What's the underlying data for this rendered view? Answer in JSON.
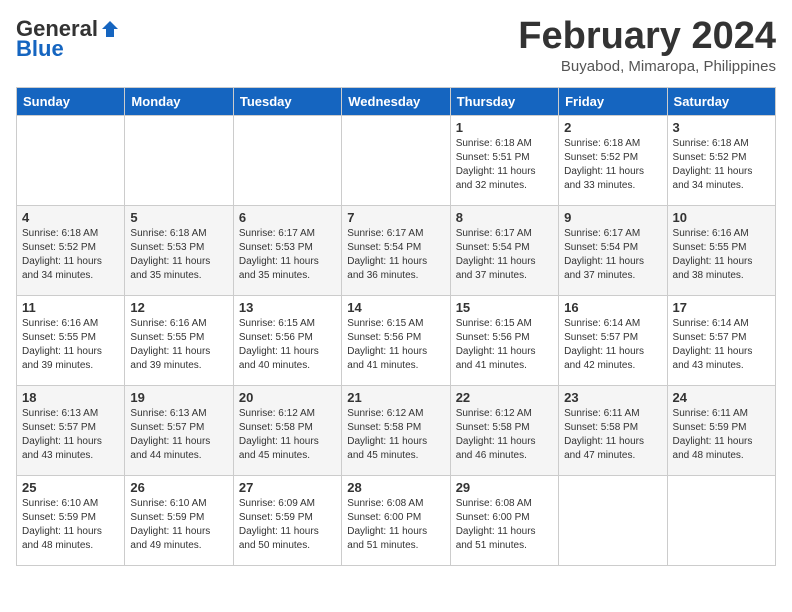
{
  "header": {
    "logo_general": "General",
    "logo_blue": "Blue",
    "month_title": "February 2024",
    "subtitle": "Buyabod, Mimaropa, Philippines"
  },
  "weekdays": [
    "Sunday",
    "Monday",
    "Tuesday",
    "Wednesday",
    "Thursday",
    "Friday",
    "Saturday"
  ],
  "weeks": [
    [
      {
        "day": "",
        "info": ""
      },
      {
        "day": "",
        "info": ""
      },
      {
        "day": "",
        "info": ""
      },
      {
        "day": "",
        "info": ""
      },
      {
        "day": "1",
        "info": "Sunrise: 6:18 AM\nSunset: 5:51 PM\nDaylight: 11 hours\nand 32 minutes."
      },
      {
        "day": "2",
        "info": "Sunrise: 6:18 AM\nSunset: 5:52 PM\nDaylight: 11 hours\nand 33 minutes."
      },
      {
        "day": "3",
        "info": "Sunrise: 6:18 AM\nSunset: 5:52 PM\nDaylight: 11 hours\nand 34 minutes."
      }
    ],
    [
      {
        "day": "4",
        "info": "Sunrise: 6:18 AM\nSunset: 5:52 PM\nDaylight: 11 hours\nand 34 minutes."
      },
      {
        "day": "5",
        "info": "Sunrise: 6:18 AM\nSunset: 5:53 PM\nDaylight: 11 hours\nand 35 minutes."
      },
      {
        "day": "6",
        "info": "Sunrise: 6:17 AM\nSunset: 5:53 PM\nDaylight: 11 hours\nand 35 minutes."
      },
      {
        "day": "7",
        "info": "Sunrise: 6:17 AM\nSunset: 5:54 PM\nDaylight: 11 hours\nand 36 minutes."
      },
      {
        "day": "8",
        "info": "Sunrise: 6:17 AM\nSunset: 5:54 PM\nDaylight: 11 hours\nand 37 minutes."
      },
      {
        "day": "9",
        "info": "Sunrise: 6:17 AM\nSunset: 5:54 PM\nDaylight: 11 hours\nand 37 minutes."
      },
      {
        "day": "10",
        "info": "Sunrise: 6:16 AM\nSunset: 5:55 PM\nDaylight: 11 hours\nand 38 minutes."
      }
    ],
    [
      {
        "day": "11",
        "info": "Sunrise: 6:16 AM\nSunset: 5:55 PM\nDaylight: 11 hours\nand 39 minutes."
      },
      {
        "day": "12",
        "info": "Sunrise: 6:16 AM\nSunset: 5:55 PM\nDaylight: 11 hours\nand 39 minutes."
      },
      {
        "day": "13",
        "info": "Sunrise: 6:15 AM\nSunset: 5:56 PM\nDaylight: 11 hours\nand 40 minutes."
      },
      {
        "day": "14",
        "info": "Sunrise: 6:15 AM\nSunset: 5:56 PM\nDaylight: 11 hours\nand 41 minutes."
      },
      {
        "day": "15",
        "info": "Sunrise: 6:15 AM\nSunset: 5:56 PM\nDaylight: 11 hours\nand 41 minutes."
      },
      {
        "day": "16",
        "info": "Sunrise: 6:14 AM\nSunset: 5:57 PM\nDaylight: 11 hours\nand 42 minutes."
      },
      {
        "day": "17",
        "info": "Sunrise: 6:14 AM\nSunset: 5:57 PM\nDaylight: 11 hours\nand 43 minutes."
      }
    ],
    [
      {
        "day": "18",
        "info": "Sunrise: 6:13 AM\nSunset: 5:57 PM\nDaylight: 11 hours\nand 43 minutes."
      },
      {
        "day": "19",
        "info": "Sunrise: 6:13 AM\nSunset: 5:57 PM\nDaylight: 11 hours\nand 44 minutes."
      },
      {
        "day": "20",
        "info": "Sunrise: 6:12 AM\nSunset: 5:58 PM\nDaylight: 11 hours\nand 45 minutes."
      },
      {
        "day": "21",
        "info": "Sunrise: 6:12 AM\nSunset: 5:58 PM\nDaylight: 11 hours\nand 45 minutes."
      },
      {
        "day": "22",
        "info": "Sunrise: 6:12 AM\nSunset: 5:58 PM\nDaylight: 11 hours\nand 46 minutes."
      },
      {
        "day": "23",
        "info": "Sunrise: 6:11 AM\nSunset: 5:58 PM\nDaylight: 11 hours\nand 47 minutes."
      },
      {
        "day": "24",
        "info": "Sunrise: 6:11 AM\nSunset: 5:59 PM\nDaylight: 11 hours\nand 48 minutes."
      }
    ],
    [
      {
        "day": "25",
        "info": "Sunrise: 6:10 AM\nSunset: 5:59 PM\nDaylight: 11 hours\nand 48 minutes."
      },
      {
        "day": "26",
        "info": "Sunrise: 6:10 AM\nSunset: 5:59 PM\nDaylight: 11 hours\nand 49 minutes."
      },
      {
        "day": "27",
        "info": "Sunrise: 6:09 AM\nSunset: 5:59 PM\nDaylight: 11 hours\nand 50 minutes."
      },
      {
        "day": "28",
        "info": "Sunrise: 6:08 AM\nSunset: 6:00 PM\nDaylight: 11 hours\nand 51 minutes."
      },
      {
        "day": "29",
        "info": "Sunrise: 6:08 AM\nSunset: 6:00 PM\nDaylight: 11 hours\nand 51 minutes."
      },
      {
        "day": "",
        "info": ""
      },
      {
        "day": "",
        "info": ""
      }
    ]
  ]
}
